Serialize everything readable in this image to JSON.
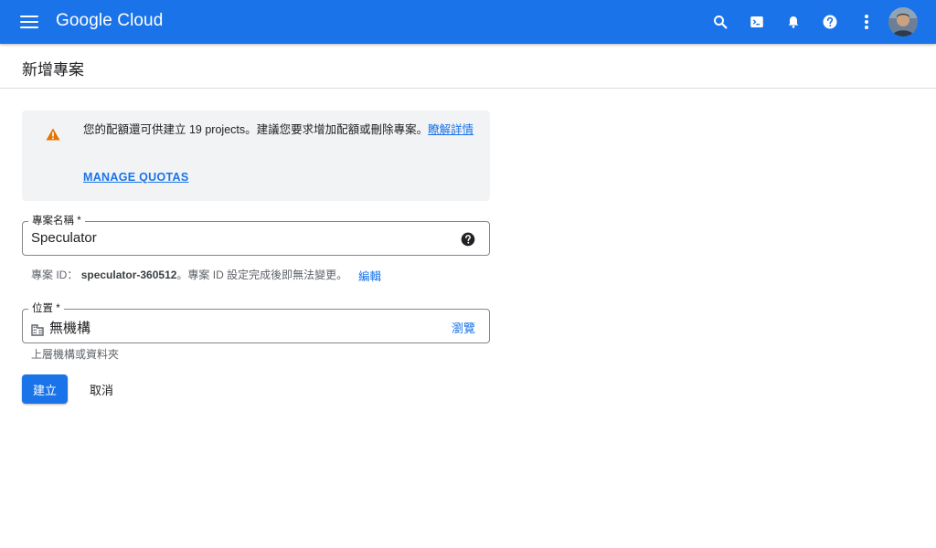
{
  "topbar": {
    "brand": "Google Cloud",
    "icons": [
      "menu-icon",
      "search-icon",
      "cloud-shell-icon",
      "notifications-icon",
      "help-icon",
      "more-vert-icon"
    ],
    "color": "#1a73e8"
  },
  "page": {
    "title": "新增專案"
  },
  "notice": {
    "text_before": "您的配額還可供建立 19 projects。建議您要求增加配額或刪除專案。",
    "learn_more": "瞭解詳情",
    "action": "MANAGE QUOTAS",
    "icon": "warning-icon",
    "icon_color": "#e37400"
  },
  "project_name": {
    "label": "專案名稱 *",
    "value": "Speculator",
    "id_label": "專案 ID：",
    "id_value": "speculator-360512",
    "id_suffix": "。專案 ID 設定完成後即無法變更。",
    "edit_label": "編輯"
  },
  "location": {
    "label": "位置 *",
    "value": "無機構",
    "browse_label": "瀏覽",
    "hint": "上層機構或資料夾"
  },
  "actions": {
    "create_label": "建立",
    "cancel_label": "取消"
  }
}
